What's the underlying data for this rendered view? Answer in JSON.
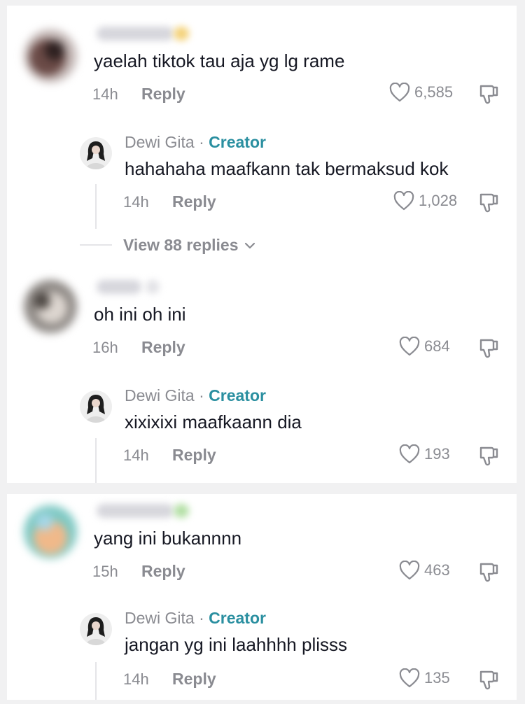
{
  "comments": [
    {
      "text": "yaelah tiktok tau aja yg lg rame",
      "time": "14h",
      "reply_label": "Reply",
      "likes": "6,585",
      "reply": {
        "author": "Dewi Gita",
        "separator": "·",
        "badge": "Creator",
        "text": "hahahaha maafkann tak bermaksud kok",
        "time": "14h",
        "reply_label": "Reply",
        "likes": "1,028"
      },
      "view_replies": "View 88 replies"
    },
    {
      "text": "oh ini oh ini",
      "time": "16h",
      "reply_label": "Reply",
      "likes": "684",
      "reply": {
        "author": "Dewi Gita",
        "separator": "·",
        "badge": "Creator",
        "text": "xixixixi maafkaann dia",
        "time": "14h",
        "reply_label": "Reply",
        "likes": "193"
      }
    },
    {
      "text": "yang ini bukannnn",
      "time": "15h",
      "reply_label": "Reply",
      "likes": "463",
      "reply": {
        "author": "Dewi Gita",
        "separator": "·",
        "badge": "Creator",
        "text": "jangan yg ini laahhhh plisss",
        "time": "14h",
        "reply_label": "Reply",
        "likes": "135"
      }
    }
  ],
  "icons": {
    "like": "heart-outline-icon",
    "dislike": "thumbs-down-icon",
    "expand": "chevron-down-icon"
  },
  "colors": {
    "creator_badge": "#2a8fa0",
    "secondary_text": "#8a8b91",
    "primary_text": "#161823"
  }
}
